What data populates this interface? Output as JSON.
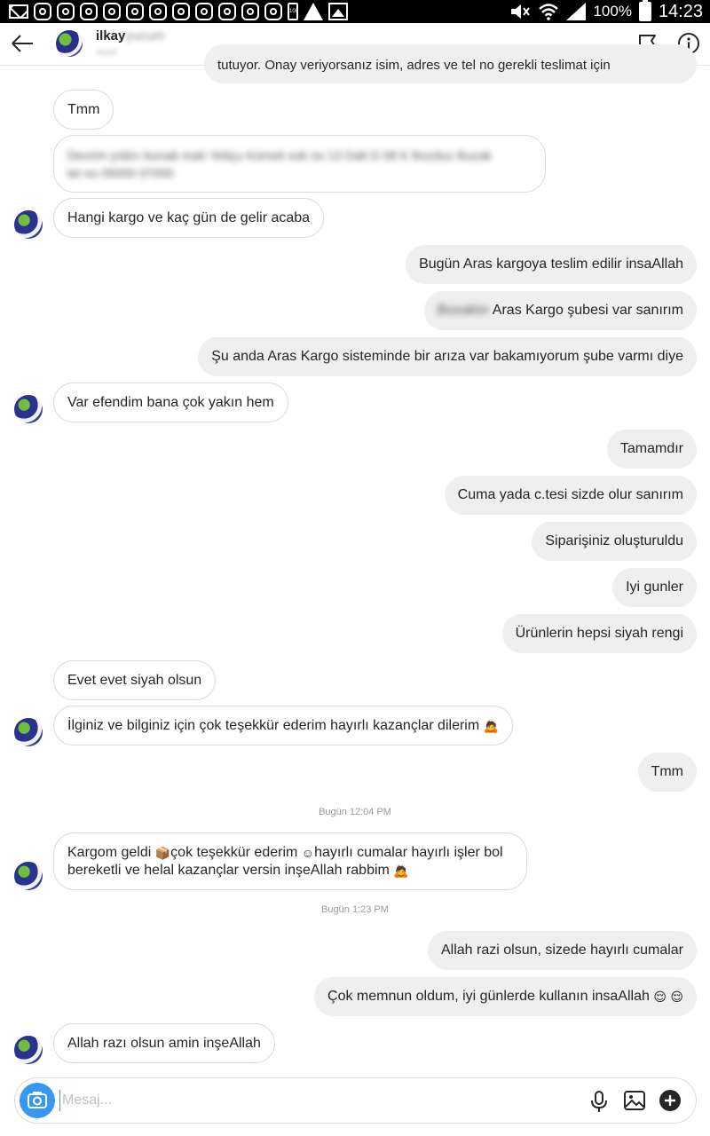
{
  "status_bar": {
    "battery_percent": "100%",
    "time": "14:23",
    "small_battery_text": "100"
  },
  "header": {
    "contact_name": "ilkay",
    "contact_name_blurred": "yucum",
    "subtitle_blurred": "Aktif"
  },
  "messages": {
    "m0_out_partial": "tutuyor. Onay veriyorsanız isim, adres ve tel no gerekli teslimat için",
    "m1_in": "Tmm",
    "m2_in_blurred_line1": "Devrim yıldırı bunab mah Yeltçu Kümeli sok no 13 Dalt D 08 K Bozduz Buzak",
    "m2_in_blurred_line2": "tel no 05000 07000",
    "m3_in": "Hangi kargo ve kaç gün de gelir acaba",
    "m4_out": "Bugün Aras kargoya teslim edilir insaAllah",
    "m5_out_blurred": "Bozaktır",
    "m5_out": "Aras Kargo şubesi var sanırım",
    "m6_out": "Şu anda Aras Kargo sisteminde bir arıza var bakamıyorum şube varmı diye",
    "m7_in": "Var efendim bana çok yakın hem",
    "m8_out": "Tamamdır",
    "m9_out": "Cuma yada c.tesi sizde olur sanırım",
    "m10_out": "Siparişiniz oluşturuldu",
    "m11_out": "Iyi gunler",
    "m12_out": "Ürünlerin hepsi siyah rengi",
    "m13_in": "Evet evet siyah olsun",
    "m14_in": "İlginiz ve bilginiz için çok teşekkür ederim hayırlı kazançlar dilerim",
    "m15_out": "Tmm",
    "ts1": "Bugün 12:04 PM",
    "m16_in_a": "Kargom geldi",
    "m16_in_b": "çok teşekkür ederim",
    "m16_in_c": "hayırlı cumalar hayırlı işler bol",
    "m16_in_line2": "bereketli ve helal kazançlar versin inşeAllah rabbim",
    "ts2": "Bugün 1:23 PM",
    "m17_out": "Allah razi olsun, sizede hayırlı cumalar",
    "m18_out": "Çok memnun oldum, iyi günlerde kullanın insaAllah",
    "m19_in": "Allah razı olsun amin inşeAllah"
  },
  "composer": {
    "placeholder": "Mesaj..."
  },
  "colors": {
    "accent": "#3897f0",
    "incoming_border": "#dbdbdb",
    "outgoing_bg": "#efefef"
  },
  "icons": {
    "back": "arrow-left-icon",
    "flag": "flag-icon",
    "info": "info-icon",
    "camera": "camera-icon",
    "mic": "microphone-icon",
    "gallery": "image-icon",
    "plus": "plus-circle-icon"
  }
}
